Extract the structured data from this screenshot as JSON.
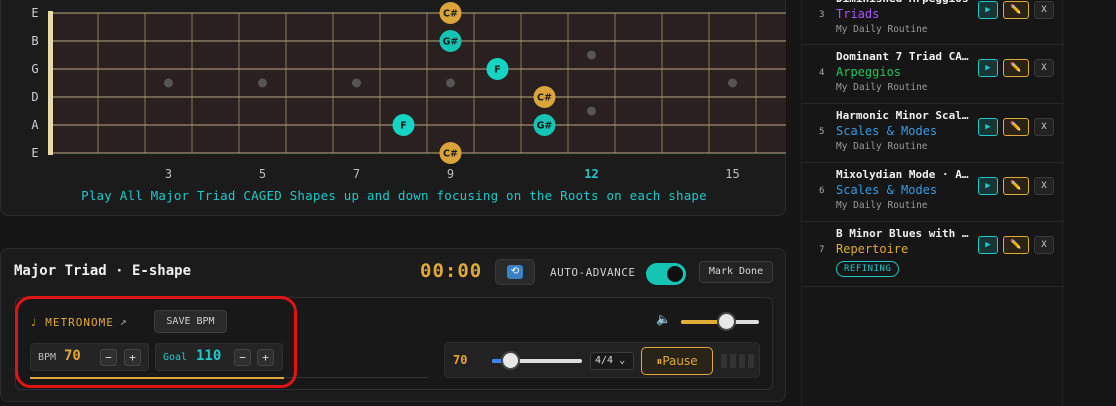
{
  "fretboard": {
    "strings": [
      "E",
      "B",
      "G",
      "D",
      "A",
      "E"
    ],
    "fret_numbers": [
      "3",
      "5",
      "7",
      "9",
      "12",
      "15"
    ],
    "notes": [
      {
        "label": "C#",
        "string": 0,
        "fret": 9,
        "type": "root"
      },
      {
        "label": "G#",
        "string": 1,
        "fret": 9,
        "type": "fifth"
      },
      {
        "label": "F",
        "string": 2,
        "fret": 10,
        "type": "third"
      },
      {
        "label": "C#",
        "string": 3,
        "fret": 11,
        "type": "root"
      },
      {
        "label": "F",
        "string": 4,
        "fret": 8,
        "type": "third"
      },
      {
        "label": "G#",
        "string": 4,
        "fret": 11,
        "type": "fifth"
      },
      {
        "label": "C#",
        "string": 5,
        "fret": 9,
        "type": "root"
      }
    ],
    "caption": "Play All Major Triad CAGED Shapes up and down focusing on the Roots on each shape"
  },
  "exercise": {
    "title": "Major Triad · E-shape",
    "timer": "00:00",
    "loop_icon": "repeat-icon",
    "auto_advance_label": "AUTO-ADVANCE",
    "auto_advance_on": true,
    "mark_done_label": "Mark Done"
  },
  "metronome": {
    "label": "♩ METRONOME",
    "popout_icon": "↗",
    "save_bpm_label": "SAVE BPM",
    "bpm_label": "BPM",
    "bpm_value": "70",
    "goal_label": "Goal",
    "goal_value": "110",
    "minus": "−",
    "plus": "+",
    "volume_icon": "🔈",
    "volume_level": 0.58,
    "current_bpm": "70",
    "tempo_level": 0.2,
    "time_signature": "4/4",
    "sig_chevron": "⌄",
    "pause_label": "⏸Pause"
  },
  "routine_list": [
    {
      "num": "3",
      "title": "Diminished Arpeggios",
      "category": "Triads",
      "category_color": "#a855f7",
      "subtitle": "My Daily Routine",
      "badge": ""
    },
    {
      "num": "4",
      "title": "Dominant 7 Triad CA…",
      "category": "Arpeggios",
      "category_color": "#22c55e",
      "subtitle": "My Daily Routine",
      "badge": ""
    },
    {
      "num": "5",
      "title": "Harmonic Minor Scal…",
      "category": "Scales & Modes",
      "category_color": "#3b9be0",
      "subtitle": "My Daily Routine",
      "badge": ""
    },
    {
      "num": "6",
      "title": "Mixolydian Mode · A…",
      "category": "Scales & Modes",
      "category_color": "#3b9be0",
      "subtitle": "My Daily Routine",
      "badge": ""
    },
    {
      "num": "7",
      "title": "B Minor Blues with …",
      "category": "Repertoire",
      "category_color": "#e0a93a",
      "subtitle": "",
      "badge": "REFINING"
    }
  ],
  "actions": {
    "play": "▶",
    "edit": "✏️",
    "remove": "X"
  },
  "colors": {
    "accent_gold": "#e0a93a",
    "accent_teal": "#22c8c8",
    "annotation_red": "#e01414"
  }
}
